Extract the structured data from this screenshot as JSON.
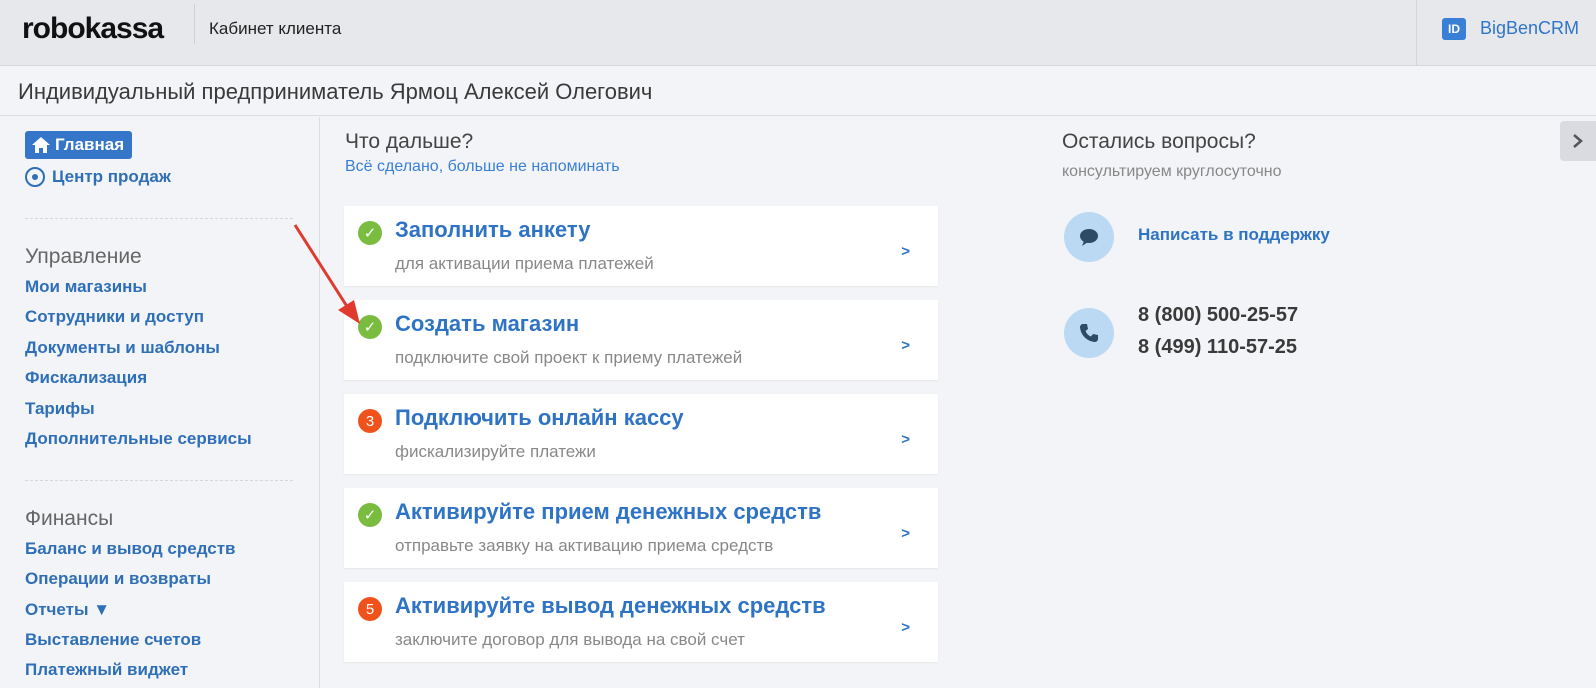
{
  "header": {
    "logo": "robokassa",
    "cabinet_title": "Кабинет клиента",
    "id_badge": "ID",
    "user_name": "BigBenCRM"
  },
  "company": {
    "name": "Индивидуальный предприниматель Ярмоц Алексей Олегович"
  },
  "sidebar": {
    "home_label": "Главная",
    "sales_center_label": "Центр продаж",
    "management": {
      "title": "Управление",
      "items": [
        "Мои магазины",
        "Сотрудники и доступ",
        "Документы и шаблоны",
        "Фискализация",
        "Тарифы",
        "Дополнительные сервисы"
      ]
    },
    "finance": {
      "title": "Финансы",
      "items": [
        "Баланс и вывод средств",
        "Операции и возвраты",
        "Отчеты ▼",
        "Выставление счетов",
        "Платежный виджет"
      ]
    }
  },
  "main": {
    "title": "Что дальше?",
    "dismiss_link": "Всё сделано, больше не напоминать",
    "steps": [
      {
        "status": "done",
        "badge": "✓",
        "title": "Заполнить анкету",
        "subtitle": "для активации приема платежей",
        "arrow": ">"
      },
      {
        "status": "done",
        "badge": "✓",
        "title": "Создать магазин",
        "subtitle": "подключите свой проект к приему платежей",
        "arrow": ">"
      },
      {
        "status": "todo",
        "badge": "3",
        "title": "Подключить онлайн кассу",
        "subtitle": "фискализируйте платежи",
        "arrow": ">"
      },
      {
        "status": "done",
        "badge": "✓",
        "title": "Активируйте прием денежных средств",
        "subtitle": "отправьте заявку на активацию приема средств",
        "arrow": ">"
      },
      {
        "status": "todo",
        "badge": "5",
        "title": "Активируйте вывод денежных средств",
        "subtitle": "заключите договор для вывода на свой счет",
        "arrow": ">"
      }
    ]
  },
  "help": {
    "title": "Остались вопросы?",
    "subtitle": "консультируем круглосуточно",
    "support_link": "Написать в поддержку",
    "phones": [
      "8 (800) 500-25-57",
      "8 (499) 110-57-25"
    ]
  },
  "colors": {
    "accent": "#2f73c4",
    "done": "#79bc40",
    "todo": "#f0521c",
    "annotation_arrow": "#e03a2e"
  }
}
